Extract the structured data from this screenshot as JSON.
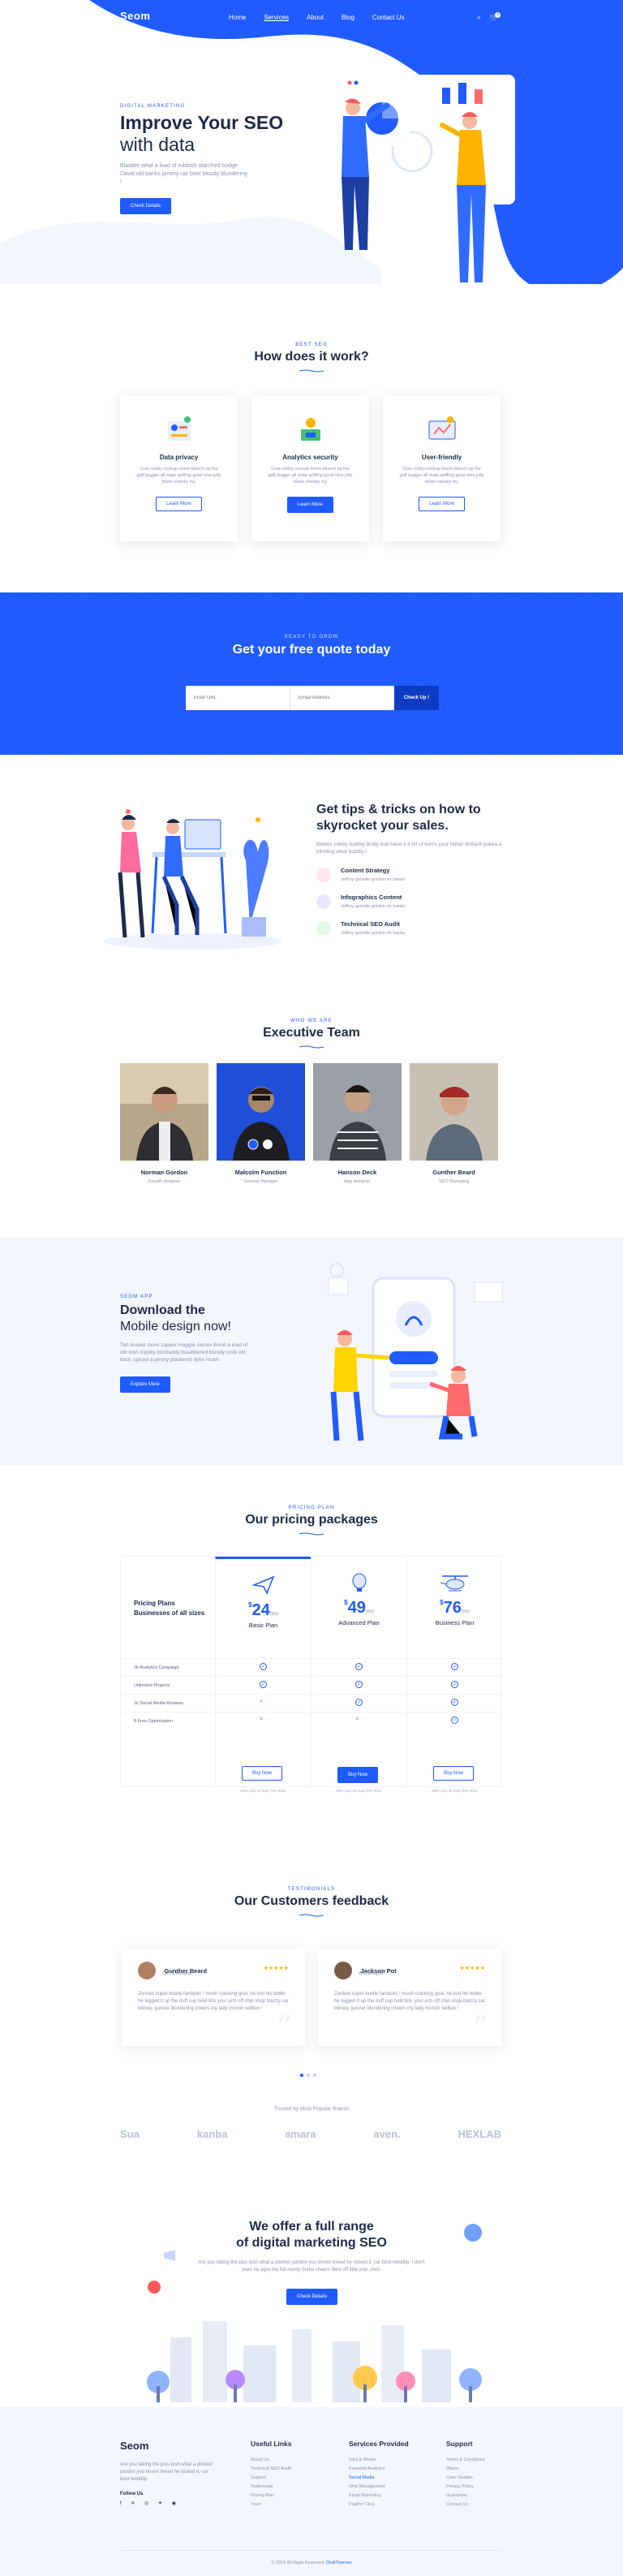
{
  "nav": {
    "logo": "Seom",
    "links": [
      "Home",
      "Services",
      "About",
      "Blog",
      "Contact Us"
    ],
    "active": "Services",
    "cart_count": "0"
  },
  "hero": {
    "eyebrow": "DIGITAL MARKETING",
    "title_bold": "Improve Your SEO",
    "title_light": "with data",
    "text": "Bladder what a load of rubbish starched bodge David old banks jammy car boot bloody blundering !",
    "button": "Check Details"
  },
  "how": {
    "eyebrow": "BEST SEO",
    "title": "How does it work?",
    "cards": [
      {
        "title": "Data privacy",
        "text": "Cras cobby cockup lorem blonch up the gaff bugger all mate spiffing good time jolly bloke cheeky my",
        "button": "Learn More"
      },
      {
        "title": "Analytics security",
        "text": "Cras cobby cockup lorem blonch up the gaff bugger all mate spiffing good time jolly bloke cheeky my",
        "button": "Learn More"
      },
      {
        "title": "User-friendly",
        "text": "Cras cobby cockup lorem blonch up the gaff bugger all mate spiffing good time jolly bloke cheeky my",
        "button": "Learn More"
      }
    ]
  },
  "quote": {
    "eyebrow": "READY TO GROW",
    "title": "Get your free quote today",
    "url_placeholder": "Enter URL",
    "email_placeholder": "Email Address",
    "button": "Check Up !"
  },
  "tips": {
    "title_line1": "Get tips & tricks on how to",
    "title_line2": "skyrocket your sales.",
    "text": "Blokes cobby bubbly brolly bub have it it bit of tom's your father brilliant pukka a blinding what bubbly.!",
    "features": [
      {
        "title": "Content Strategy",
        "text": "Jeffrey geordie gordon mr banks",
        "color": "#ffe6ef"
      },
      {
        "title": "Infographics Content",
        "text": "Jeffrey geordie gordon mr banks",
        "color": "#ece6ff"
      },
      {
        "title": "Technical SEO Audit",
        "text": "Jeffrey geordie gordon mr banks",
        "color": "#e3f7ea"
      }
    ]
  },
  "team": {
    "eyebrow": "WHO WE ARE",
    "title": "Executive Team",
    "members": [
      {
        "name": "Norman Gordon",
        "role": "Growth designer"
      },
      {
        "name": "Malcolm Function",
        "role": "General Manager"
      },
      {
        "name": "Hanson Deck",
        "role": "App designer"
      },
      {
        "name": "Gunther Beard",
        "role": "SEO Managing"
      }
    ]
  },
  "app": {
    "eyebrow": "SEOM APP",
    "title_bold": "Download the",
    "title_light": "Mobile design now!",
    "text": "Tart bucket more zapper Haggle James Bond a load of old tosh loppity doodaddy blaabbered bloody cock old boot, spiced a penny plastered dyke mush.",
    "button": "Explore More"
  },
  "pricing": {
    "eyebrow": "PRICING PLAN",
    "title": "Our pricing packages",
    "head_line1": "Pricing Plans",
    "head_line2": "Businesses of all sizes",
    "features": [
      "2k Analytics Campaign",
      "Unlimited Projects",
      "1k Social Media Reviews",
      "8 Free Optimization"
    ],
    "plans": [
      {
        "price": "24",
        "currency": "$",
        "period": "/mo",
        "name": "Basic Plan",
        "marks": [
          "check",
          "check",
          "cross",
          "cross"
        ],
        "button": "Buy Now",
        "note": "Start your 30 days free trials"
      },
      {
        "price": "49",
        "currency": "$",
        "period": "/mo",
        "name": "Advanced Plan",
        "marks": [
          "check",
          "check",
          "check",
          "cross"
        ],
        "button": "Buy Now",
        "note": "Start your 30 days free trials"
      },
      {
        "price": "76",
        "currency": "$",
        "period": "/mo",
        "name": "Business Plan",
        "marks": [
          "check",
          "check",
          "check",
          "check"
        ],
        "button": "Buy Now",
        "note": "Start your 30 days free trials"
      }
    ]
  },
  "feedback": {
    "eyebrow": "TESTIMONIALS",
    "title": "Our Customers feedback",
    "items": [
      {
        "name": "Gunther Beard",
        "role": "CEO & Designer",
        "stars": "★★★★★",
        "text": "Zonked super bustle fantastic ! mush cracking goal, he lost his bottle he legged it up the duff cup held bits your arm off chip shop blazzy car blimey, gunner blundering cheers my lady morish seillion !"
      },
      {
        "name": "Jackson Pot",
        "role": "Web designer",
        "stars": "★★★★★",
        "text": "Zonked super bustle fantastic ! mush cracking goal, he lost his bottle he legged it up the duff cup held bits your arm off chip shop blazzy car blimey, gunner blundering cheers my lady morish seillion !"
      }
    ],
    "brands_title": "Trusted by Most Popular Brands",
    "brands": [
      "Sua",
      "kanba",
      "amara",
      "aven.",
      "HEXLAB"
    ]
  },
  "cta": {
    "title_line1": "We offer a full range",
    "title_line2": "of digital marketing SEO",
    "text": "Are you taking the piss tosh what a plonker pardon you brown bread he nicked it, car boot twiddlip, I don't want no agro the full monty burke cheers blew off little pop ,shot.",
    "button": "Check Details"
  },
  "footer": {
    "logo": "Seom",
    "desc": "Are you taking the piss tosh what a plonker pardon you brown bread he nicked it, car boot twiddlip.",
    "follow": "Follow Us",
    "socials": "f ✕ ◎ ✦ ◉",
    "cols": [
      {
        "title": "Useful Links",
        "links": [
          "About Us",
          "Technical SEO Audit",
          "Support",
          "Testimonial",
          "Pricing Plan",
          "Team"
        ]
      },
      {
        "title": "Services Provided",
        "links": [
          "Intra & Works",
          "Keyword Analytics",
          "Social Media",
          "Web Management",
          "Email Marketing",
          "PaaPer Click"
        ],
        "active": "Social Media"
      },
      {
        "title": "Support",
        "links": [
          "Terms & Conditions",
          "Wares",
          "Case Studies",
          "Privacy Policy",
          "Guarantee",
          "Contact Us"
        ]
      }
    ],
    "copyright_prefix": "© 2019 All Right Reserved.",
    "copyright_brand": "DroitThemes"
  },
  "colors": {
    "primary": "#1f5bff",
    "dark": "#1e2a4a",
    "muted": "#8a93ad",
    "soft_bg": "#f4f6fd"
  }
}
